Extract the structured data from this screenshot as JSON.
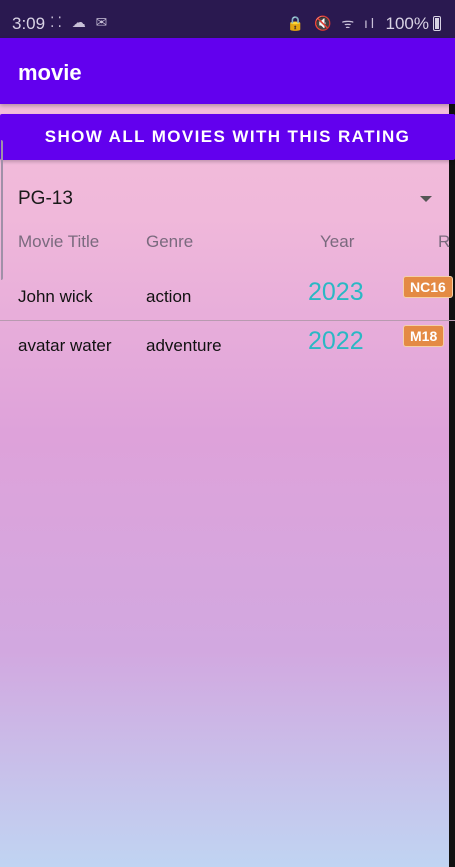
{
  "status_bar": {
    "time": "3:09",
    "left_icons": "⁚⁚ ☁ ✉",
    "right_icons": "🔒 🔇 ᯤ ıl",
    "battery": "100%"
  },
  "app_bar": {
    "title": "movie"
  },
  "show_button": {
    "label": "SHOW ALL MOVIES WITH THIS RATING"
  },
  "spinner": {
    "selected": "PG-13"
  },
  "table": {
    "headers": {
      "title": "Movie Title",
      "genre": "Genre",
      "year": "Year",
      "rating": "R"
    },
    "rows": [
      {
        "title": "John wick",
        "genre": "action",
        "year": "2023",
        "rating": "NC16"
      },
      {
        "title": "avatar water",
        "genre": "adventure",
        "year": "2022",
        "rating": "M18"
      }
    ]
  },
  "colors": {
    "primary": "#6200ee",
    "year_text": "#2ab8c4",
    "badge": "#e48a44"
  }
}
